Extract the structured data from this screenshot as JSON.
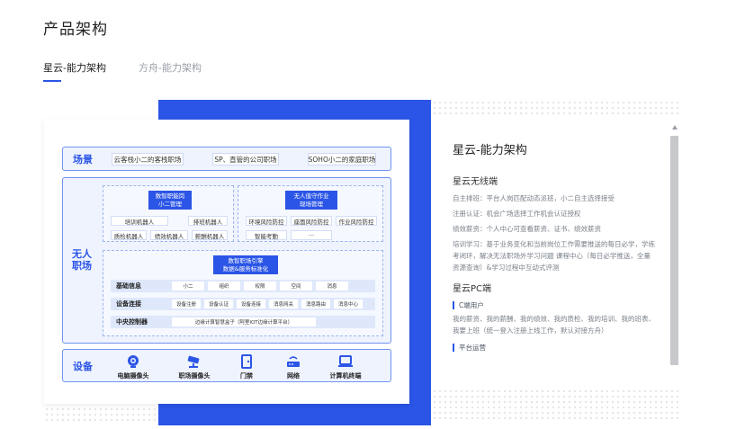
{
  "page_title": "产品架构",
  "tabs": [
    {
      "label": "星云-能力架构",
      "active": true
    },
    {
      "label": "方舟-能力架构",
      "active": false
    }
  ],
  "diagram": {
    "scene": {
      "label": "场景",
      "items": [
        "云客栈小二的客栈职场",
        "SP、直管的公司职场",
        "SOHO小二的家庭职场"
      ]
    },
    "unmanned": {
      "label": "无人\n职场",
      "smart_job": {
        "title": "数智职能岗\n小二管理",
        "items": [
          "培训机器人",
          "排班机器人",
          "薪资机器人",
          "质检机器人",
          "绩效机器人",
          "薪酬机器人"
        ]
      },
      "unattended": {
        "title": "无人值守作业\n现场管理",
        "items": [
          "环境风险防控",
          "座面风险防控",
          "作业风险防控",
          "智能考勤",
          "···"
        ]
      },
      "engine": {
        "title": "数智职场引擎\n数据&服务标准化",
        "rows": [
          {
            "label": "基础信息",
            "tags": [
              "小二",
              "组织",
              "权限",
              "空间",
              "消息"
            ]
          },
          {
            "label": "设备连接",
            "tags": [
              "设备注册",
              "设备认证",
              "设备连接",
              "消息网关",
              "消息路由",
              "消息中心"
            ]
          },
          {
            "label": "中央控制器",
            "tags": [
              "边缘计算智慧盒子（阿里IOT边缘计算平台）"
            ]
          }
        ]
      }
    },
    "devices": {
      "label": "设备",
      "items": [
        {
          "label": "电脑摄像头",
          "icon": "webcam-icon"
        },
        {
          "label": "职场摄像头",
          "icon": "cctv-icon"
        },
        {
          "label": "门禁",
          "icon": "door-icon"
        },
        {
          "label": "网络",
          "icon": "router-icon"
        },
        {
          "label": "计算机终端",
          "icon": "laptop-icon"
        }
      ]
    }
  },
  "panel": {
    "title": "星云-能力架构",
    "sections": [
      {
        "heading": "星云无线端",
        "lines": [
          "自主排班：平台人岗匹配动态派班，小二自主选择接受",
          "注册认证：机会广场选择工作机会认证授权",
          "绩效薪资：个人中心可查看薪资、证书、绩效薪资",
          "培训学习：基于业务变化和当前岗位工作需要推送的每日必学，学练考闭环，解决无法职场外学习问题 课程中心（每日必学推送，全量资源查询）&学习过程中互动式评测"
        ]
      },
      {
        "heading": "星云PC端",
        "sub": "C端用户",
        "lines": [
          "我的薪资、我的薪酬、我的绩效、我的质检、我的培训、我的班表、我要上班（统一登入注册上线工作，默认对接方舟）"
        ],
        "sub2": "平台运营"
      }
    ]
  },
  "colors": {
    "accent": "#2b55e6",
    "section_bg": "#eef3fe"
  }
}
